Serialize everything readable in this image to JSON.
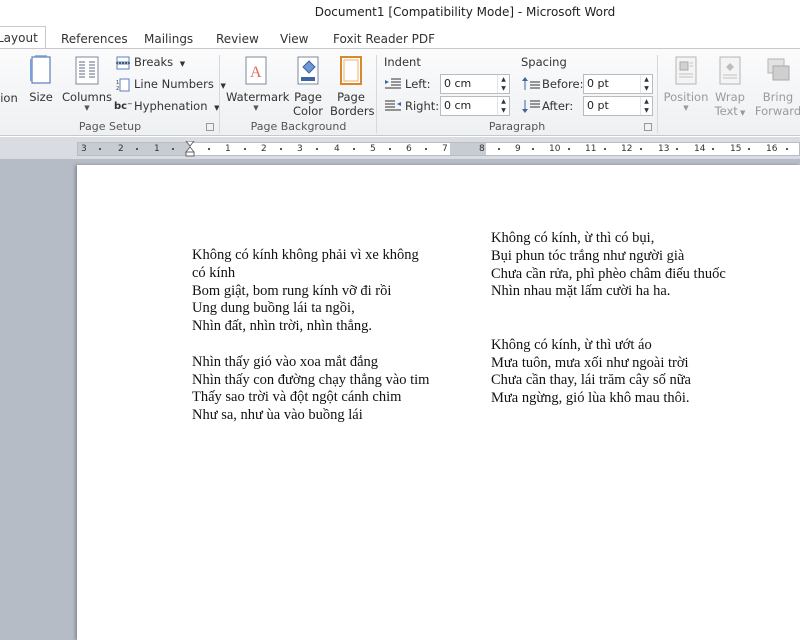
{
  "window": {
    "title": "Document1 [Compatibility Mode]  -  Microsoft Word"
  },
  "tabs": [
    "Layout",
    "References",
    "Mailings",
    "Review",
    "View",
    "Foxit Reader PDF"
  ],
  "ribbon": {
    "page_setup": {
      "orientation_label": "ion",
      "size_label": "Size",
      "columns_label": "Columns",
      "breaks_label": "Breaks",
      "line_numbers_label": "Line Numbers",
      "hyphenation_label": "Hyphenation",
      "group_label": "Page Setup"
    },
    "page_background": {
      "watermark_label": "Watermark",
      "page_color_line1": "Page",
      "page_color_line2": "Color",
      "page_borders_line1": "Page",
      "page_borders_line2": "Borders",
      "group_label": "Page Background"
    },
    "paragraph": {
      "indent_heading": "Indent",
      "left_label": "Left:",
      "left_value": "0 cm",
      "right_label": "Right:",
      "right_value": "0 cm",
      "spacing_heading": "Spacing",
      "before_label": "Before:",
      "before_value": "0 pt",
      "after_label": "After:",
      "after_value": "0 pt",
      "group_label": "Paragraph"
    },
    "arrange": {
      "position_label": "Position",
      "wrap_line1": "Wrap",
      "wrap_line2": "Text",
      "bring_line1": "Bring",
      "bring_line2": "Forward"
    }
  },
  "ruler": {
    "left_numbers": [
      "3",
      "2",
      "1"
    ],
    "right_numbers": [
      "1",
      "2",
      "3",
      "4",
      "5",
      "6",
      "7",
      "8",
      "9",
      "10",
      "11",
      "12",
      "13",
      "14",
      "15",
      "16"
    ]
  },
  "document": {
    "col1_stanza1": [
      "Không có kính không phải vì xe không",
      "có kính",
      "Bom giật, bom rung kính vỡ đi rồi",
      "Ung dung buồng lái ta ngồi,",
      "Nhìn đất, nhìn trời, nhìn thẳng."
    ],
    "col1_stanza2": [
      "Nhìn thấy gió vào xoa mắt đắng",
      "Nhìn thấy con đường chạy thẳng vào tim",
      "Thấy sao trời và đột ngột cánh chim",
      "Như sa, như ùa vào buồng lái"
    ],
    "col2_stanza1": [
      "Không có kính, ừ thì có bụi,",
      "Bụi phun tóc trắng như người già",
      "Chưa cần rửa, phì phèo châm điếu thuốc",
      "Nhìn nhau mặt lấm cười ha ha."
    ],
    "col2_stanza2": [
      "Không có kính, ừ thì ướt áo",
      "Mưa tuôn, mưa xối như ngoài trời",
      "Chưa cần thay, lái trăm cây số nữa",
      "Mưa ngừng, gió lùa khô mau thôi."
    ]
  }
}
